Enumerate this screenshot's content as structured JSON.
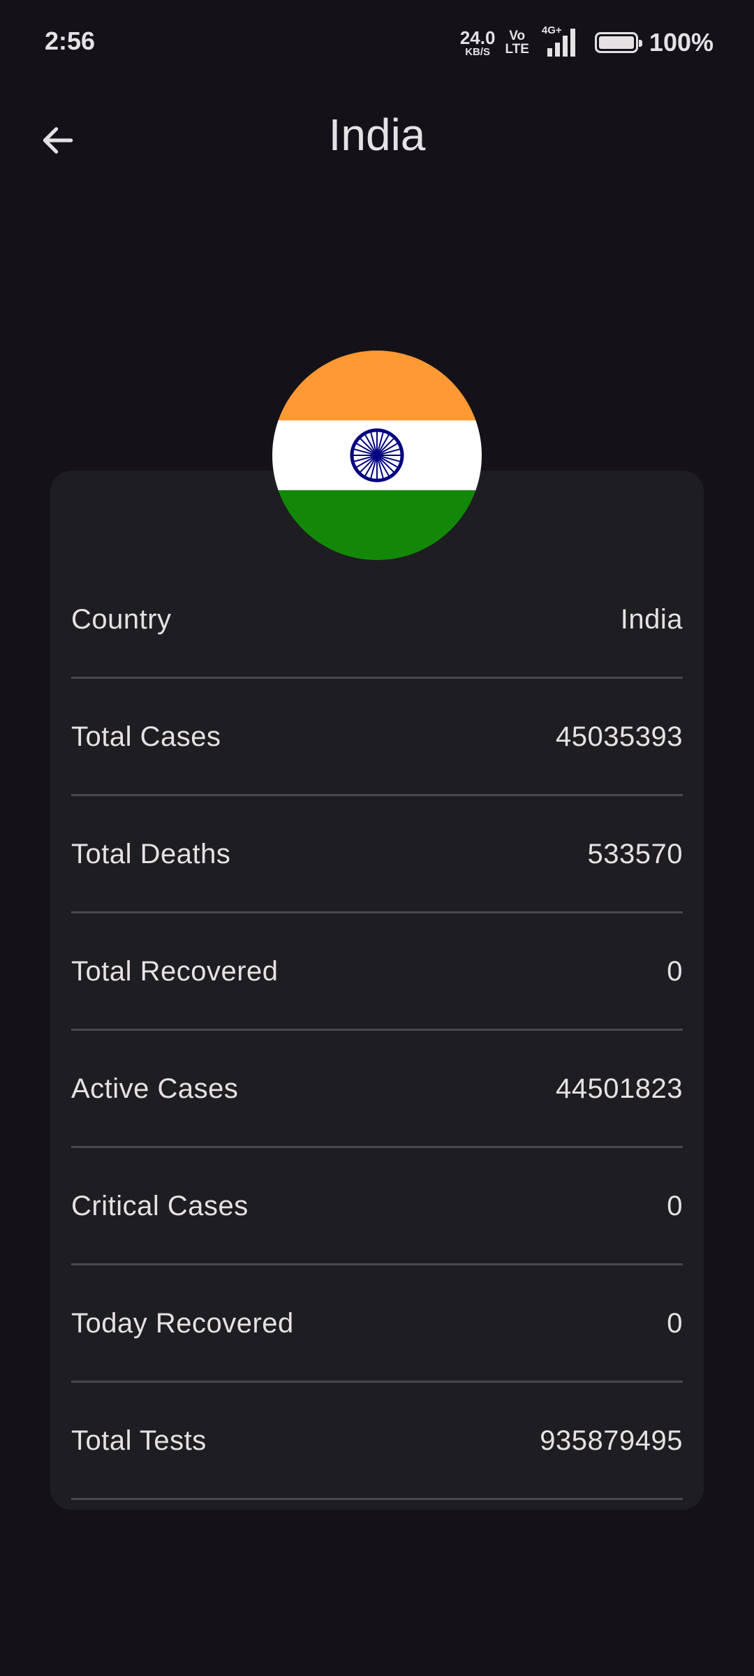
{
  "status_bar": {
    "time": "2:56",
    "net_speed_value": "24.0",
    "net_speed_unit": "KB/S",
    "volte_top": "Vo",
    "volte_bottom": "LTE",
    "network_type": "4G+",
    "battery_percent": "100%",
    "battery_level": 1.0,
    "icons": [
      "signal-icon",
      "battery-icon"
    ]
  },
  "app_bar": {
    "title": "India",
    "back_icon": "arrow-left-icon"
  },
  "flag": {
    "country": "India",
    "colors": {
      "saffron": "#FF9933",
      "white": "#FFFFFF",
      "green": "#138808",
      "chakra": "#000080"
    }
  },
  "stats": [
    {
      "label": "Country",
      "value": "India"
    },
    {
      "label": "Total Cases",
      "value": "45035393"
    },
    {
      "label": "Total Deaths",
      "value": "533570"
    },
    {
      "label": "Total Recovered",
      "value": "0"
    },
    {
      "label": "Active Cases",
      "value": "44501823"
    },
    {
      "label": "Critical Cases",
      "value": "0"
    },
    {
      "label": "Today Recovered",
      "value": "0"
    },
    {
      "label": "Total Tests",
      "value": "935879495"
    }
  ],
  "theme": {
    "background": "#141218",
    "card": "#1E1D22",
    "divider": "#4A484F",
    "text": "#E6E1E5"
  }
}
